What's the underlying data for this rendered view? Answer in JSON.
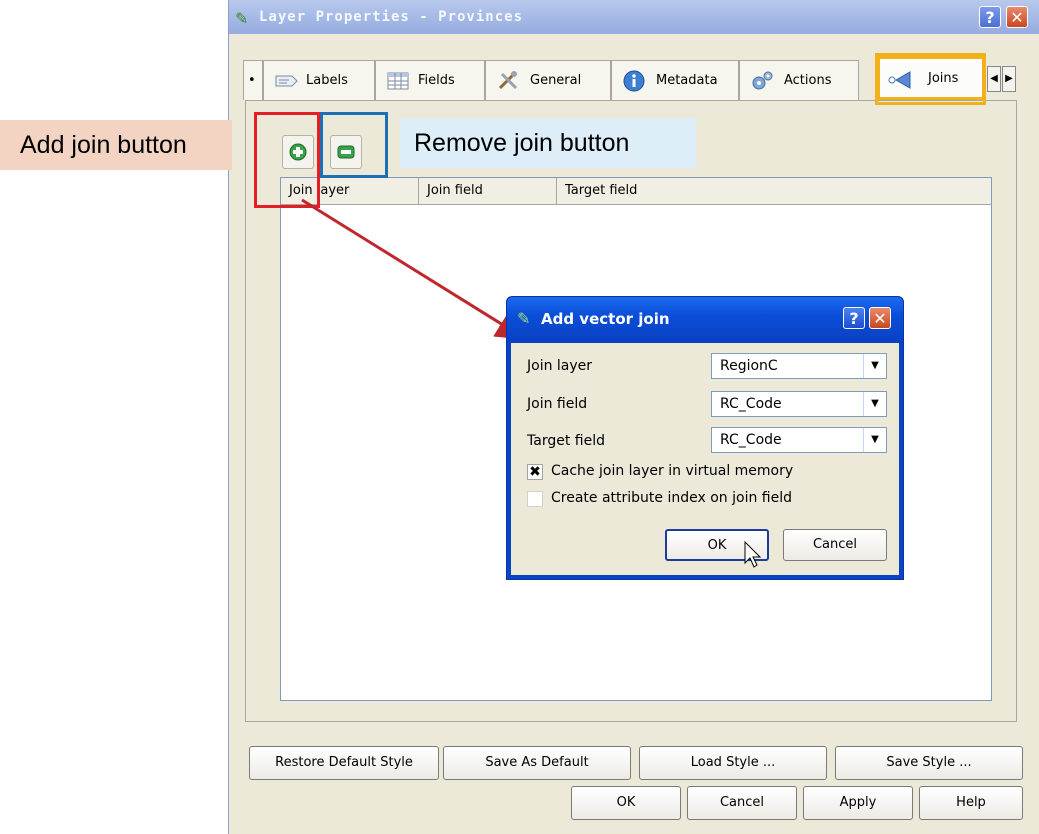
{
  "window": {
    "title": "Layer Properties - Provinces",
    "help_glyph": "?",
    "close_glyph": "✕"
  },
  "tabs": [
    {
      "label": "Labels",
      "icon": "labels-icon"
    },
    {
      "label": "Fields",
      "icon": "fields-icon"
    },
    {
      "label": "General",
      "icon": "general-tools-icon"
    },
    {
      "label": "Metadata",
      "icon": "info-icon"
    },
    {
      "label": "Actions",
      "icon": "gears-icon"
    },
    {
      "label": "Joins",
      "icon": "joins-icon",
      "active": true
    }
  ],
  "tab_scroll": {
    "left": "◀",
    "right": "▶"
  },
  "joins_table": {
    "columns": [
      "Join layer",
      "Join field",
      "Target field"
    ]
  },
  "callouts": {
    "add": "Add join button",
    "remove": "Remove join button"
  },
  "footer": {
    "row1": [
      "Restore Default Style",
      "Save As Default",
      "Load Style ...",
      "Save Style ..."
    ],
    "row2": [
      "OK",
      "Cancel",
      "Apply",
      "Help"
    ]
  },
  "dialog": {
    "title": "Add vector join",
    "fields": [
      {
        "label": "Join layer",
        "value": "RegionC"
      },
      {
        "label": "Join field",
        "value": "RC_Code"
      },
      {
        "label": "Target field",
        "value": "RC_Code"
      }
    ],
    "checkboxes": [
      {
        "label": "Cache join layer in virtual memory",
        "checked": true,
        "mark": "✖"
      },
      {
        "label": "Create attribute index on join field",
        "checked": false,
        "mark": ""
      }
    ],
    "ok": "OK",
    "cancel": "Cancel"
  },
  "colors": {
    "add_highlight": "#e01f26",
    "remove_highlight": "#1f6fb5",
    "tab_highlight": "#f2b01a",
    "arrow": "#c0272d",
    "add_callout_bg": "#f3d4c3",
    "remove_callout_bg": "#ddeef8"
  }
}
